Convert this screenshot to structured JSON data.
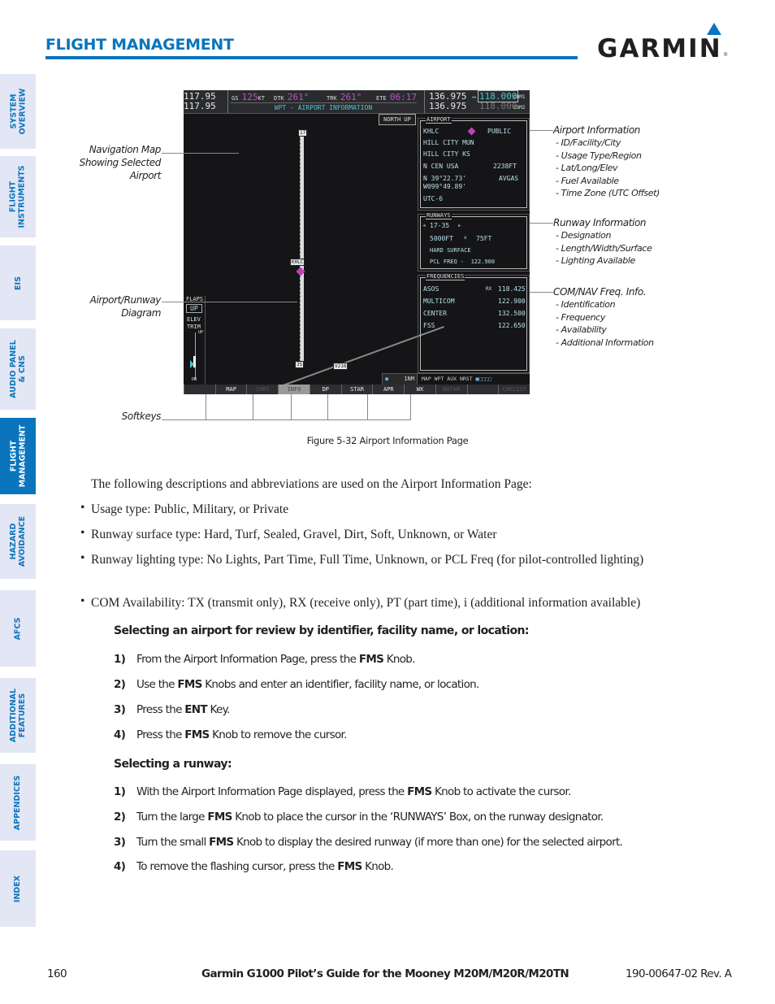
{
  "header": {
    "section_title": "FLIGHT MANAGEMENT",
    "logo_text": "GARMIN",
    "logo_registered": "®"
  },
  "side_tabs": [
    {
      "label": "SYSTEM\nOVERVIEW",
      "active": false
    },
    {
      "label": "FLIGHT\nINSTRUMENTS",
      "active": false
    },
    {
      "label": "EIS",
      "active": false
    },
    {
      "label": "AUDIO PANEL\n& CNS",
      "active": false
    },
    {
      "label": "FLIGHT\nMANAGEMENT",
      "active": true
    },
    {
      "label": "HAZARD\nAVOIDANCE",
      "active": false
    },
    {
      "label": "AFCS",
      "active": false
    },
    {
      "label": "ADDITIONAL\nFEATURES",
      "active": false
    },
    {
      "label": "APPENDICES",
      "active": false
    },
    {
      "label": "INDEX",
      "active": false
    }
  ],
  "figure": {
    "caption": "Figure 5-32  Airport Information Page",
    "display": {
      "nav1": "117.95",
      "nav2": "117.95",
      "gs_label": "GS",
      "gs_value": "125",
      "gs_unit": "KT",
      "dtk_label": "DTK",
      "dtk_value": "261°",
      "trk_label": "TRK",
      "trk_value": "261°",
      "ete_label": "ETE",
      "ete_value": "06:17",
      "page_title": "WPT - AIRPORT INFORMATION",
      "com1_active": "136.975",
      "com_swap": "↔",
      "com1_standby": "118.000",
      "com1_label": "COM1",
      "com2_active": "136.975",
      "com2_standby": "118.000",
      "com2_label": "COM2",
      "orientation": "NORTH UP",
      "map": {
        "runway_end_north": "17",
        "runway_end_south": "35",
        "airport_tag": "KHLC",
        "airway_tag": "V216",
        "range": "1NM"
      },
      "flaps": {
        "label": "FLAPS",
        "value": "UP",
        "trim_label_1": "ELEV",
        "trim_label_2": "TRIM",
        "trim_up": "UP",
        "trim_dn": "DN"
      },
      "airport_box": {
        "title": "AIRPORT",
        "ident": "KHLC",
        "usage": "PUBLIC",
        "facility": "HILL CITY MUN",
        "city": "HILL CITY KS",
        "region": "N CEN USA",
        "elevation": "2238FT",
        "lat": "N 39°22.73'",
        "lon": "W099°49.89'",
        "fuel": "AVGAS",
        "timezone": "UTC-6"
      },
      "runways_box": {
        "title": "RUNWAYS",
        "designation": "17-35",
        "length": "5000FT",
        "by": "x",
        "width": "75FT",
        "surface": "HARD SURFACE",
        "lighting": "PCL FREQ -  122.900"
      },
      "frequencies_box": {
        "title": "FREQUENCIES",
        "rows": [
          {
            "name": "ASOS",
            "avail": "RX",
            "freq": "118.425"
          },
          {
            "name": "MULTICOM",
            "avail": "",
            "freq": "122.900"
          },
          {
            "name": "CENTER",
            "avail": "",
            "freq": "132.500"
          },
          {
            "name": "FSS",
            "avail": "",
            "freq": "122.650"
          }
        ]
      },
      "page_group": "MAP WPT AUX NRST",
      "softkeys": [
        {
          "label": "",
          "state": "blank"
        },
        {
          "label": "MAP",
          "state": "normal"
        },
        {
          "label": "CHRT",
          "state": "dim"
        },
        {
          "label": "INFO",
          "state": "selected"
        },
        {
          "label": "DP",
          "state": "normal"
        },
        {
          "label": "STAR",
          "state": "normal"
        },
        {
          "label": "APR",
          "state": "normal"
        },
        {
          "label": "WX",
          "state": "normal"
        },
        {
          "label": "NOTAM",
          "state": "dim"
        },
        {
          "label": "",
          "state": "blank"
        },
        {
          "label": "CHKLIST",
          "state": "dim"
        }
      ]
    },
    "callouts": {
      "nav_map": [
        "Navigation Map",
        "Showing Selected",
        "Airport"
      ],
      "apt_rwy": [
        "Airport/Runway",
        "Diagram"
      ],
      "softkeys": "Softkeys",
      "airport_info": {
        "title": "Airport Information",
        "items": [
          "- ID/Facility/City",
          "- Usage Type/Region",
          "- Lat/Long/Elev",
          "- Fuel Available",
          "- Time Zone (UTC Offset)"
        ]
      },
      "runway_info": {
        "title": "Runway Information",
        "items": [
          "- Designation",
          "- Length/Width/Surface",
          "- Lighting Available"
        ]
      },
      "freq_info": {
        "title": "COM/NAV Freq. Info.",
        "items": [
          "- Identification",
          "- Frequency",
          "- Availability",
          "- Additional Information"
        ]
      }
    }
  },
  "body": {
    "intro": "The following descriptions and abbreviations are used on the Airport Information Page:",
    "bullets": [
      "Usage type: Public, Military, or Private",
      "Runway surface type: Hard, Turf, Sealed, Gravel, Dirt, Soft, Unknown, or Water",
      "Runway lighting type: No Lights, Part Time, Full Time, Unknown, or PCL Freq (for pilot-controlled lighting)",
      "COM Availability: TX (transmit only), RX (receive only), PT (part time), i (additional information available)"
    ],
    "procedures": [
      {
        "title": "Selecting an airport for review by identifier, facility name, or location:",
        "steps": [
          {
            "num": "1)",
            "pre": "From the Airport Information Page, press the ",
            "bold": "FMS",
            "post": " Knob."
          },
          {
            "num": "2)",
            "pre": "Use the ",
            "bold": "FMS",
            "post": " Knobs and enter an identifier, facility name, or location."
          },
          {
            "num": "3)",
            "pre": "Press the ",
            "bold": "ENT",
            "post": " Key."
          },
          {
            "num": "4)",
            "pre": "Press the ",
            "bold": "FMS",
            "post": " Knob to remove the cursor."
          }
        ]
      },
      {
        "title": "Selecting a runway:",
        "steps": [
          {
            "num": "1)",
            "pre": "With the Airport Information Page displayed, press the ",
            "bold": "FMS",
            "post": " Knob to activate the cursor."
          },
          {
            "num": "2)",
            "pre": "Turn the large ",
            "bold": "FMS",
            "post": " Knob to place the cursor in the ‘RUNWAYS’ Box, on the runway designator."
          },
          {
            "num": "3)",
            "pre": "Turn the small ",
            "bold": "FMS",
            "post": " Knob to display the desired runway (if more than one) for the selected airport."
          },
          {
            "num": "4)",
            "pre": "To remove the flashing cursor, press the ",
            "bold": "FMS",
            "post": " Knob."
          }
        ]
      }
    ]
  },
  "footer": {
    "page_number": "160",
    "title": "Garmin G1000 Pilot’s Guide for the Mooney M20M/M20R/M20TN",
    "doc_number": "190-00647-02  Rev. A"
  },
  "colors": {
    "brand_blue": "#0a75bc",
    "tab_bg": "#e3e6f4",
    "display_magenta": "#c050c8",
    "display_cyan": "#49c8d0"
  }
}
